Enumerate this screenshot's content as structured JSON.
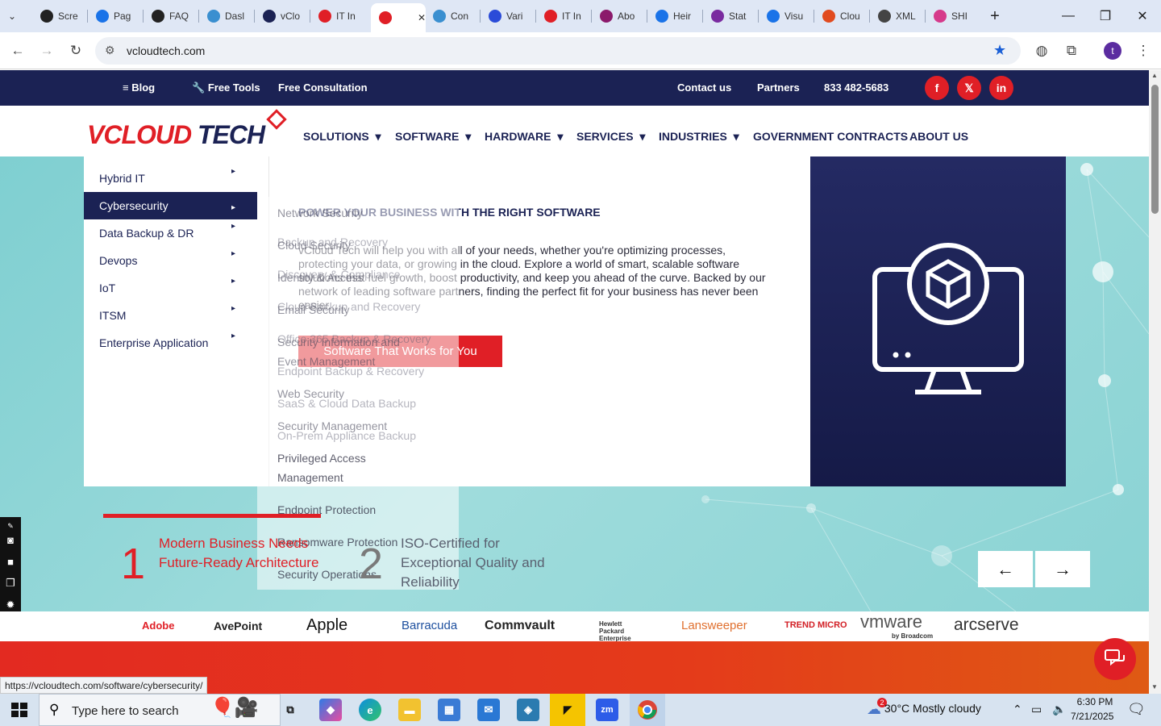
{
  "browser": {
    "tabs": [
      {
        "title": "Scre",
        "color": "#222222"
      },
      {
        "title": "Pag",
        "color": "#1a73e8"
      },
      {
        "title": "FAQ",
        "color": "#222222"
      },
      {
        "title": "Dasl",
        "color": "#3a8fd0"
      },
      {
        "title": "vClo",
        "color": "#1b2254"
      },
      {
        "title": "IT In",
        "color": "#e01f26"
      },
      {
        "title": "",
        "color": "#e01f26"
      },
      {
        "title": "Con",
        "color": "#3a8fd0"
      },
      {
        "title": "Vari",
        "color": "#2a4bd8"
      },
      {
        "title": "IT In",
        "color": "#e01f26"
      },
      {
        "title": "Abo",
        "color": "#8b1a6b"
      },
      {
        "title": "Heir",
        "color": "#1a73e8"
      },
      {
        "title": "Stat",
        "color": "#7a2ba0"
      },
      {
        "title": "Visu",
        "color": "#1a73e8"
      },
      {
        "title": "Clou",
        "color": "#e14b1f"
      },
      {
        "title": "XML",
        "color": "#444444"
      },
      {
        "title": "SHI",
        "color": "#d63a8b"
      }
    ],
    "url": "vcloudtech.com",
    "status_url": "https://vcloudtech.com/software/cybersecurity/",
    "profile_initial": "t"
  },
  "topbar": {
    "blog": "Blog",
    "free_tools": "Free Tools",
    "free_consultation": "Free Consultation",
    "contact": "Contact us",
    "partners": "Partners",
    "phone": "833 482-5683",
    "social": [
      "f",
      "𝕏",
      "in"
    ]
  },
  "logo": {
    "part1": "VCLOUD",
    "part2": "TECH"
  },
  "nav": [
    "SOLUTIONS",
    "SOFTWARE",
    "HARDWARE",
    "SERVICES",
    "INDUSTRIES",
    "GOVERNMENT CONTRACTS",
    "ABOUT US"
  ],
  "menu_left": [
    {
      "label": "Hybrid IT",
      "active": false
    },
    {
      "label": "Cybersecurity",
      "active": true
    },
    {
      "label": "Data Backup & DR",
      "active": false
    },
    {
      "label": "Devops",
      "active": false
    },
    {
      "label": "IoT",
      "active": false
    },
    {
      "label": "ITSM",
      "active": false
    },
    {
      "label": "Enterprise Application",
      "active": false
    }
  ],
  "submenu_a": [
    "Network Security",
    "Cloud Security",
    "Identity & Access",
    "Email Security",
    "Security Information and",
    "Event Management",
    "Web Security",
    "Security Management",
    "Privileged Access",
    "Management",
    "Endpoint Protection",
    "Ransomware Protection",
    "Security Operations"
  ],
  "submenu_b": [
    "Backup and Recovery",
    "Discovery & Compliance",
    "Cloud Backup and Recovery",
    "Office 365 Backup & Recovery",
    "Endpoint Backup & Recovery",
    "SaaS & Cloud Data Backup",
    "On-Prem Appliance Backup"
  ],
  "hero": {
    "title": "POWER YOUR BUSINESS WITH THE RIGHT SOFTWARE",
    "description": "vCloud Tech will help you with all of your needs, whether you're optimizing processes, protecting your data, or growing in the cloud. Explore a world of smart, scalable software solutions that fuel growth, boost productivity, and keep you ahead of the curve. Backed by our network of leading software partners, finding the perfect fit for your business has never been easier.",
    "button": "Software That Works for You"
  },
  "features": [
    {
      "num": "1",
      "text": "Modern Business Needs Future-Ready Architecture"
    },
    {
      "num": "2",
      "text": "ISO-Certified for Exceptional Quality and Reliability"
    }
  ],
  "slider": {
    "prev": "←",
    "next": "→"
  },
  "brands": [
    "Adobe",
    "AvePoint",
    "Apple",
    "Barracuda",
    "Commvault",
    "Hewlett Packard Enterprise",
    "Lansweeper",
    "TREND MICRO",
    "vmware",
    "by Broadcom",
    "arcserve"
  ],
  "taskbar": {
    "search_placeholder": "Type here to search",
    "weather": "30°C  Mostly cloudy",
    "weather_badge": "2",
    "time": "6:30 PM",
    "date": "7/21/2025"
  },
  "colors": {
    "brand_red": "#e01f26",
    "brand_navy": "#1b2254"
  }
}
